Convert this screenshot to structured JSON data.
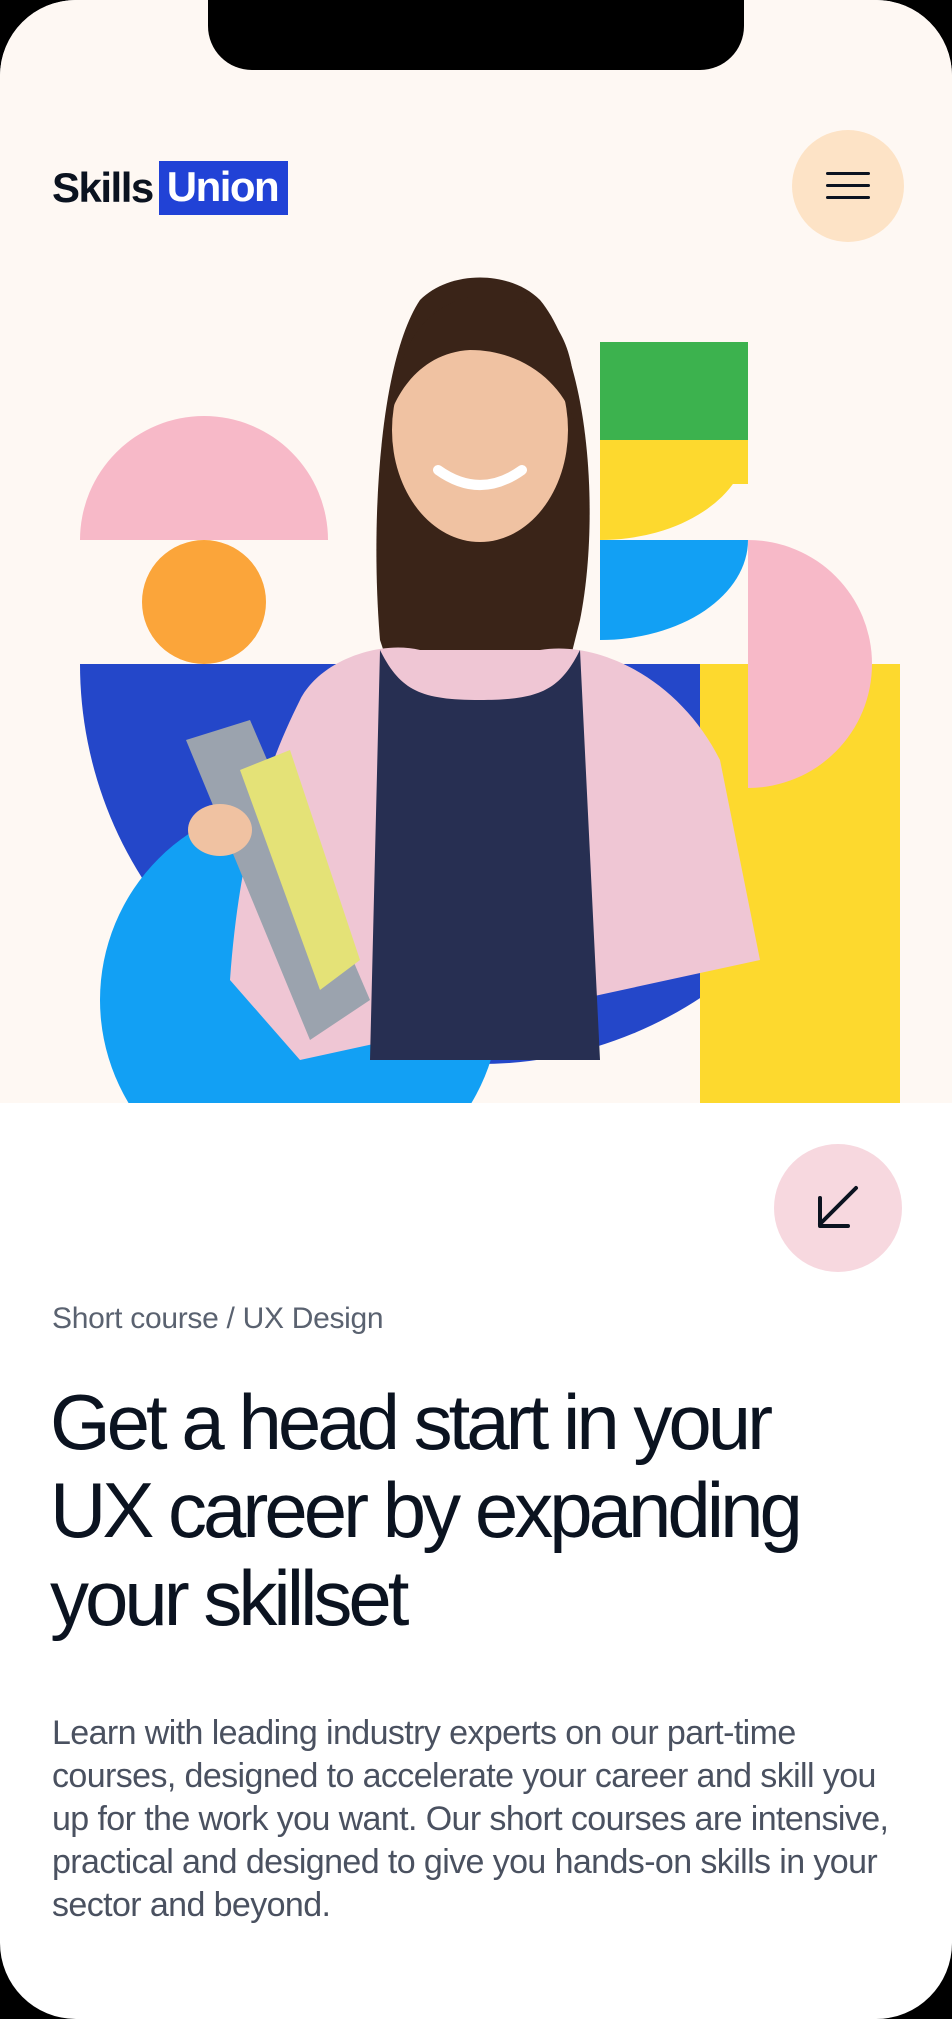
{
  "header": {
    "logo_word_1": "Skills",
    "logo_word_2": "Union",
    "logo_accent_color": "#2142d6",
    "menu_icon": "hamburger-icon"
  },
  "hero": {
    "image_subject": "smiling student holding a laptop and folder",
    "shape_colors": [
      "#f7b9c8",
      "#fba53a",
      "#2447c9",
      "#12a0f4",
      "#3cb24e",
      "#fdd92e"
    ]
  },
  "scroll_button": {
    "icon": "arrow-down-left-icon"
  },
  "content": {
    "breadcrumb": "Short course / UX Design",
    "headline_lines": [
      "Get a head start in your",
      "UX career by expanding",
      "your skillset"
    ],
    "description": "Learn with leading industry experts on our part-time courses, designed to accelerate your career and skill you up for the work you want. Our short courses are intensive, practical and designed to give you hands-on skills in your sector and beyond."
  }
}
